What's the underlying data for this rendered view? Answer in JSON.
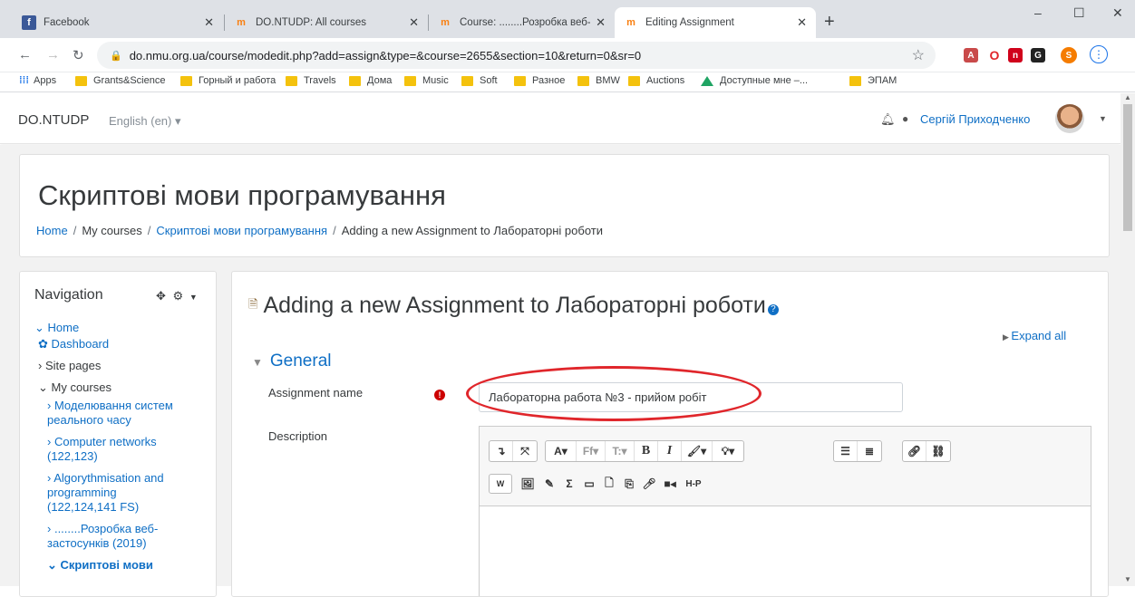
{
  "browser": {
    "tabs": [
      {
        "label": "Facebook",
        "icon": "facebook-icon"
      },
      {
        "label": "DO.NTUDP: All courses",
        "icon": "moodle-icon"
      },
      {
        "label": "Course: ........Розробка веб-застс",
        "icon": "moodle-icon"
      },
      {
        "label": "Editing Assignment",
        "icon": "moodle-icon"
      }
    ],
    "new_tab": "+",
    "window_controls": {
      "minimize": "–",
      "maximize": "☐",
      "close": "✕"
    },
    "url": "do.nmu.org.ua/course/modedit.php?add=assign&type=&course=2655&section=10&return=0&sr=0",
    "bookmarks": [
      "Apps",
      "Grants&Science",
      "Горный и работа",
      "Travels",
      "Дома",
      "Music",
      "Soft",
      "Разное",
      "BMW",
      "Auctions",
      "Доступные мне –...",
      "ЭПАМ"
    ],
    "profile_initial": "S"
  },
  "navbar": {
    "brand": "DO.NTUDP",
    "language": "English (en) ▾",
    "user": "Сергій Приходченко"
  },
  "header": {
    "course_title": "Скриптові мови програмування",
    "breadcrumb": [
      "Home",
      "My courses",
      "Скриптові мови програмування",
      "Adding a new Assignment to Лабораторні роботи"
    ]
  },
  "navigation": {
    "title": "Navigation",
    "items": [
      {
        "text": "Home",
        "prefix": "⌄ "
      },
      {
        "text": "Dashboard",
        "prefix": ""
      },
      {
        "text": "Site pages",
        "prefix": "› "
      },
      {
        "text": "My courses",
        "prefix": "⌄ "
      },
      {
        "text": "Моделювання систем",
        "prefix": "› "
      },
      {
        "text": "реального часу",
        "prefix": ""
      },
      {
        "text": "Computer networks",
        "prefix": "› "
      },
      {
        "text": "(122,123)",
        "prefix": ""
      },
      {
        "text": "Algorythmisation and",
        "prefix": "› "
      },
      {
        "text": "programming",
        "prefix": ""
      },
      {
        "text": "(122,124,141 FS)",
        "prefix": ""
      },
      {
        "text": "........Розробка веб-",
        "prefix": "› "
      },
      {
        "text": "застосунків (2019)",
        "prefix": ""
      },
      {
        "text": "Скриптові мови",
        "prefix": "⌄ "
      }
    ]
  },
  "main": {
    "page_title": "Adding a new Assignment to Лабораторні роботи",
    "expand_all": "Expand all",
    "section": "General",
    "assignment_name_label": "Assignment name",
    "assignment_name_value": "Лабораторна работа №3 - прийом робіт",
    "description_label": "Description"
  },
  "accent_color": "#0f6fc5"
}
